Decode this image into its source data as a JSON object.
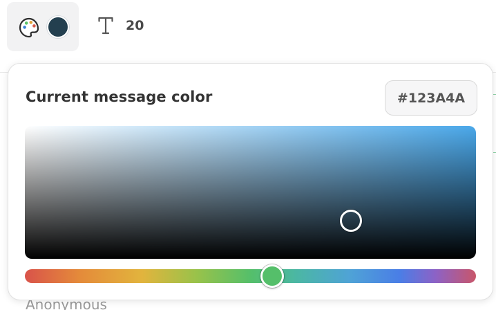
{
  "toolbar": {
    "palette_icon": "palette-icon",
    "current_color": "#233F4F",
    "text_icon": "text-icon",
    "font_size": "20"
  },
  "popover": {
    "title": "Current message color",
    "hex_value": "#123A4A",
    "hue_handle_color": "#55BF6A",
    "saturation_area_color": "#4AA8EA"
  },
  "background": {
    "author_label": "Anonymous"
  }
}
